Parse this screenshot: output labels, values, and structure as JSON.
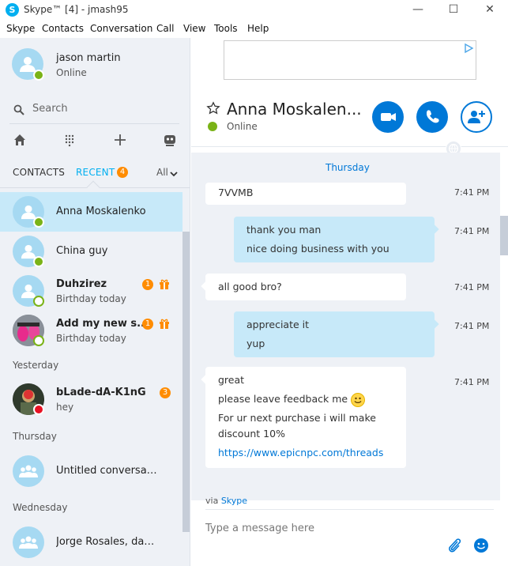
{
  "window": {
    "app_icon": "S",
    "title": "Skype™ [4] - jmash95",
    "controls": {
      "minimize": "—",
      "maximize": "☐",
      "close": "✕"
    }
  },
  "menu": [
    "Skype",
    "Contacts",
    "Conversation",
    "Call",
    "View",
    "Tools",
    "Help"
  ],
  "profile": {
    "name": "jason martin",
    "status": "Online"
  },
  "search": {
    "label": "Search"
  },
  "toolbar_icons": [
    "home-icon",
    "dialpad-icon",
    "plus-icon",
    "bot-icon"
  ],
  "tabs": {
    "contacts": "CONTACTS",
    "recent": "RECENT",
    "recent_count": "4",
    "filter": "All"
  },
  "sections": {
    "yesterday": "Yesterday",
    "thursday": "Thursday",
    "wednesday": "Wednesday"
  },
  "conversations": [
    {
      "name": "Anna Moskalenko",
      "sub": "",
      "badge": "",
      "presence": "online",
      "selected": true
    },
    {
      "name": "China guy",
      "sub": "",
      "badge": "",
      "presence": "online"
    },
    {
      "name": "Duhzirez",
      "sub": "Birthday today",
      "badge": "1",
      "presence": "away",
      "gift": true
    },
    {
      "name": "Add my new s...",
      "sub": "Birthday today",
      "badge": "1",
      "presence": "away",
      "gift": true
    },
    {
      "name": "bLade-dA-K1nG",
      "sub": "hey",
      "badge": "3",
      "presence": "dnd"
    },
    {
      "name": "Untitled conversation",
      "sub": "",
      "badge": "",
      "presence": "group"
    },
    {
      "name": "Jorge Rosales, damari...",
      "sub": "",
      "badge": "",
      "presence": "group"
    }
  ],
  "chat": {
    "title": "Anna Moskalen...",
    "status": "Online",
    "day": "Thursday",
    "messages": [
      {
        "dir": "in",
        "lines": [
          "7VVMB"
        ],
        "time": "7:41 PM"
      },
      {
        "dir": "out",
        "lines": [
          "thank you man",
          "nice doing business with you"
        ],
        "time": "7:41 PM"
      },
      {
        "dir": "in",
        "lines": [
          "all good bro?"
        ],
        "time": "7:41 PM"
      },
      {
        "dir": "out",
        "lines": [
          "appreciate it",
          "yup"
        ],
        "time": "7:41 PM"
      },
      {
        "dir": "in",
        "lines": [
          "great",
          "please leave feedback me",
          "For ur next purchase i will make",
          "discount 10%"
        ],
        "link": "https://www.epicnpc.com/threads",
        "time": "7:41 PM"
      }
    ],
    "via_prefix": "via",
    "via_name": "Skype",
    "compose_placeholder": "Type a message here"
  },
  "colors": {
    "accent": "#00aff0",
    "call_blue": "#0078d7",
    "online": "#7ab317",
    "badge": "#ff8c00",
    "selected": "#c7e9f9"
  }
}
